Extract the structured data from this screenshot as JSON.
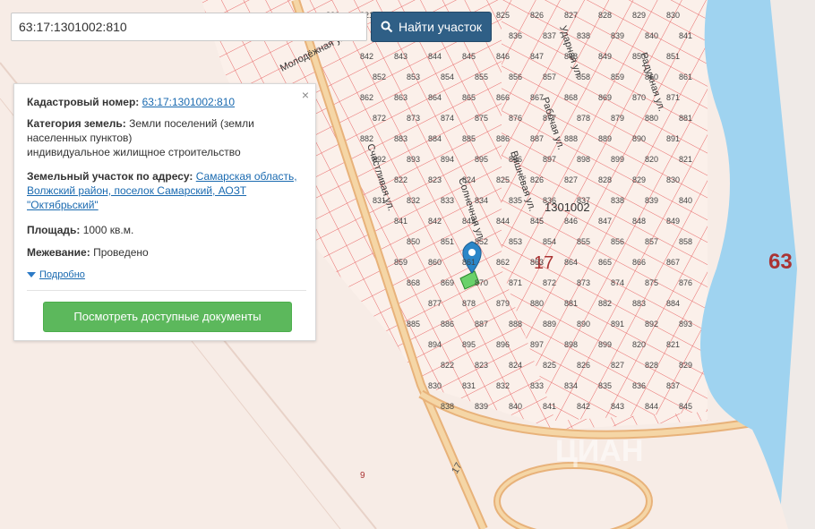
{
  "search": {
    "value": "63:17:1301002:810",
    "button_label": "Найти участок"
  },
  "info": {
    "cadastral_label": "Кадастровый номер:",
    "cadastral_value": "63:17:1301002:810",
    "category_label": "Категория земель:",
    "category_value": "Земли поселений (земли населенных пунктов)",
    "category_use": "индивидуальное жилищное строительство",
    "address_label": "Земельный участок по адресу:",
    "address_value": "Самарская область, Волжский район, поселок Самарский, АОЗТ \"Октябрьский\"",
    "area_label": "Площадь:",
    "area_value": "1000 кв.м.",
    "survey_label": "Межевание:",
    "survey_value": "Проведено",
    "more_label": "Подробно",
    "close_glyph": "×",
    "docs_button": "Посмотреть доступные документы"
  },
  "map": {
    "block_label": "1301002",
    "quarter_label": "17",
    "district_label": "63",
    "road_label": "17",
    "road_sign": "9",
    "watermark": "ЦИАН",
    "streets": [
      "Молодёжная ул.",
      "Счастливая ул.",
      "Солнечная ул.",
      "Вишнёвая ул.",
      "Ударная ул.",
      "Рабочая ул.",
      "Радужная ул."
    ],
    "parcel_numbers": [
      "820",
      "821",
      "822",
      "823",
      "824",
      "825",
      "826",
      "827",
      "828",
      "829",
      "830",
      "831",
      "832",
      "833",
      "834",
      "835",
      "836",
      "837",
      "838",
      "839",
      "840",
      "841",
      "842",
      "843",
      "844",
      "845",
      "846",
      "847",
      "848",
      "849",
      "850",
      "851",
      "852",
      "853",
      "854",
      "855",
      "856",
      "857",
      "858",
      "859",
      "860",
      "861",
      "862",
      "863",
      "864",
      "865",
      "866",
      "867",
      "868",
      "869",
      "870",
      "871",
      "872",
      "873",
      "874",
      "875",
      "876",
      "877",
      "878",
      "879",
      "880",
      "881",
      "882",
      "883",
      "884",
      "885",
      "886",
      "887",
      "888",
      "889",
      "890",
      "891",
      "892",
      "893",
      "894",
      "895",
      "896",
      "897",
      "898",
      "899"
    ],
    "colors": {
      "bg": "#f7ece6",
      "parcel": "#e86a6a",
      "road": "#f1c98f",
      "water": "#9fd3f0",
      "green": "#d6ecd2",
      "pin": "#2b86c8",
      "selected": "#6ad16a"
    }
  }
}
